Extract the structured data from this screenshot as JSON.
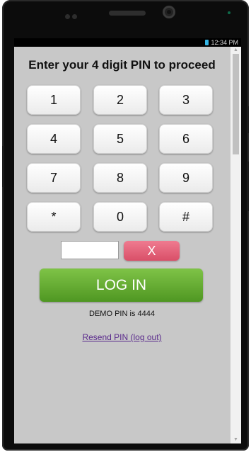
{
  "statusbar": {
    "time": "12:34 PM"
  },
  "page": {
    "title": "Enter your 4 digit PIN to proceed",
    "keys": [
      "1",
      "2",
      "3",
      "4",
      "5",
      "6",
      "7",
      "8",
      "9",
      "*",
      "0",
      "#"
    ],
    "pin_value": "",
    "clear_label": "X",
    "login_label": "LOG IN",
    "demo_text": "DEMO PIN is 4444",
    "resend_link": "Resend PIN (log out)"
  },
  "colors": {
    "login": "#5fa52c",
    "clear": "#e4607a",
    "screen_bg": "#c8c8c8",
    "link": "#5a2a8c"
  }
}
